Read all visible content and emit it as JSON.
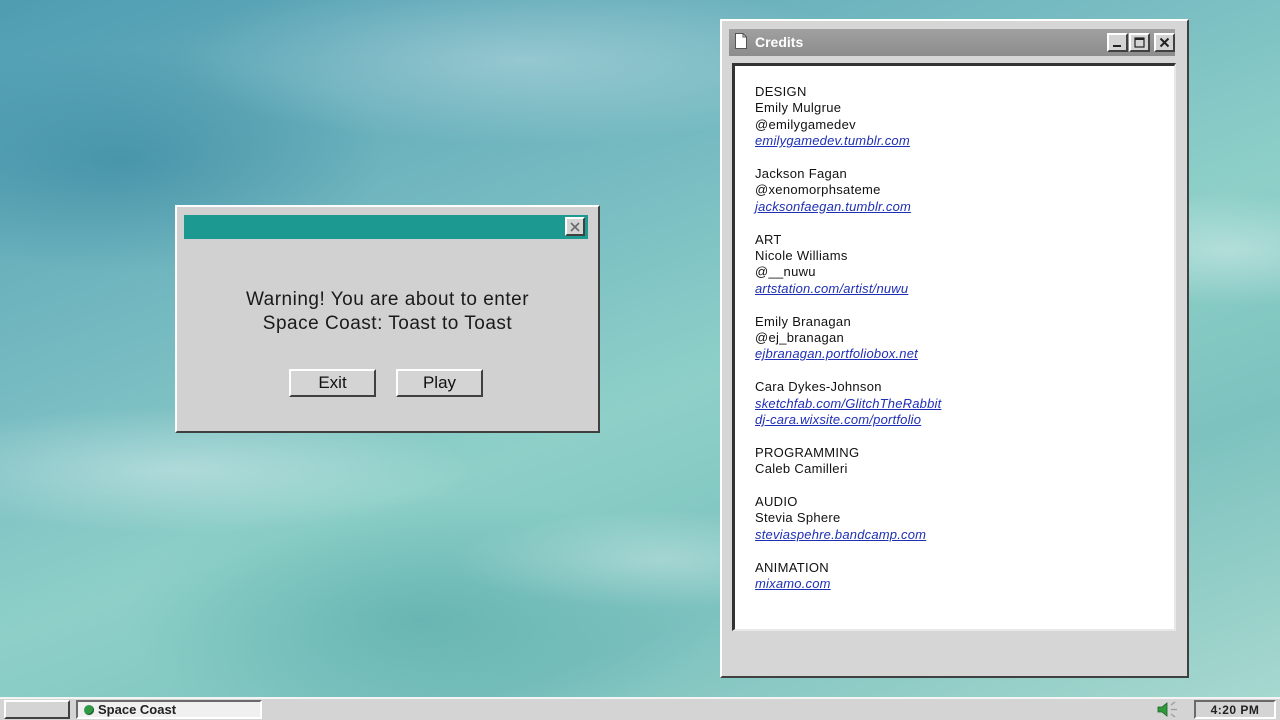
{
  "warning_dialog": {
    "title": "",
    "message_line1": "Warning! You are about to enter",
    "message_line2": "Space Coast: Toast to Toast",
    "exit_label": "Exit",
    "play_label": "Play",
    "close_icon": "close-icon",
    "titlebar_color": "#1c9a91"
  },
  "credits_window": {
    "title": "Credits",
    "icon": "document-icon",
    "sections": [
      {
        "lines": [
          {
            "text": "DESIGN",
            "link": false
          },
          {
            "text": "Emily Mulgrue",
            "link": false
          },
          {
            "text": "@emilygamedev",
            "link": false
          },
          {
            "text": "emilygamedev.tumblr.com",
            "link": true
          }
        ]
      },
      {
        "lines": [
          {
            "text": "Jackson Fagan",
            "link": false
          },
          {
            "text": "@xenomorphsateme",
            "link": false
          },
          {
            "text": "jacksonfaegan.tumblr.com",
            "link": true
          }
        ]
      },
      {
        "lines": [
          {
            "text": "ART",
            "link": false
          },
          {
            "text": "Nicole Williams",
            "link": false
          },
          {
            "text": "@__nuwu",
            "link": false
          },
          {
            "text": "artstation.com/artist/nuwu",
            "link": true
          }
        ]
      },
      {
        "lines": [
          {
            "text": "Emily Branagan",
            "link": false
          },
          {
            "text": "@ej_branagan",
            "link": false
          },
          {
            "text": "ejbranagan.portfoliobox.net",
            "link": true
          }
        ]
      },
      {
        "lines": [
          {
            "text": "Cara Dykes-Johnson",
            "link": false
          },
          {
            "text": "sketchfab.com/GlitchTheRabbit",
            "link": true
          },
          {
            "text": "dj-cara.wixsite.com/portfolio",
            "link": true
          }
        ]
      },
      {
        "lines": [
          {
            "text": "PROGRAMMING",
            "link": false
          },
          {
            "text": "Caleb Camilleri",
            "link": false
          }
        ]
      },
      {
        "lines": [
          {
            "text": "AUDIO",
            "link": false
          },
          {
            "text": "Stevia Sphere",
            "link": false
          },
          {
            "text": "steviaspehre.bandcamp.com",
            "link": true
          }
        ]
      },
      {
        "lines": [
          {
            "text": "ANIMATION",
            "link": false
          },
          {
            "text": "mixamo.com",
            "link": true
          }
        ]
      }
    ],
    "link_color": "#1f2fb5"
  },
  "taskbar": {
    "task_label": "Space Coast",
    "task_icon": "green-dot-icon",
    "speaker_icon": "speaker-icon",
    "clock": "4:20 PM"
  }
}
